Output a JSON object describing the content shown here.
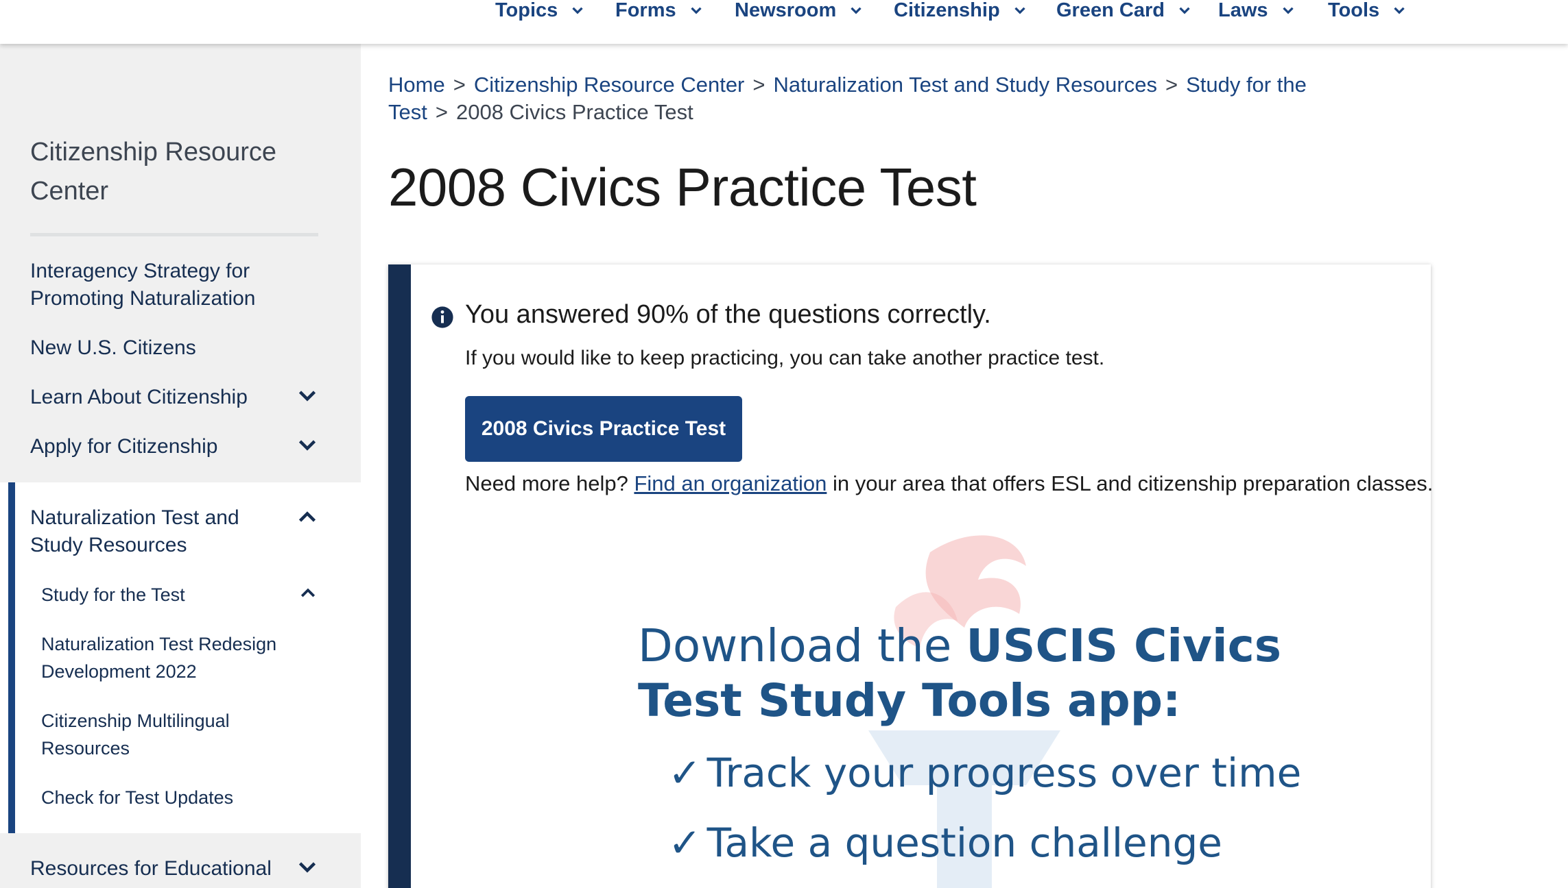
{
  "topnav": {
    "items": [
      {
        "label": "Topics"
      },
      {
        "label": "Forms"
      },
      {
        "label": "Newsroom"
      },
      {
        "label": "Citizenship"
      },
      {
        "label": "Green Card"
      },
      {
        "label": "Laws"
      },
      {
        "label": "Tools"
      }
    ]
  },
  "sidebar": {
    "title": "Citizenship Resource Center",
    "items": [
      {
        "label": "Interagency Strategy for Promoting Naturalization"
      },
      {
        "label": "New U.S. Citizens"
      },
      {
        "label": "Learn About Citizenship"
      },
      {
        "label": "Apply for Citizenship"
      },
      {
        "label": "Naturalization Test and Study Resources"
      },
      {
        "label": "Resources for Educational"
      }
    ],
    "subitems": [
      {
        "label": "Study for the Test"
      },
      {
        "label": "Naturalization Test Redesign Development 2022"
      },
      {
        "label": "Citizenship Multilingual Resources"
      },
      {
        "label": "Check for Test Updates"
      }
    ]
  },
  "breadcrumb": {
    "links": [
      "Home",
      "Citizenship Resource Center",
      "Naturalization Test and Study Resources",
      "Study for the Test"
    ],
    "current": "2008 Civics Practice Test"
  },
  "page": {
    "title": "2008 Civics Practice Test"
  },
  "result_card": {
    "result_text": "You answered 90% of the questions correctly.",
    "keep_text": "If you would like to keep practicing, you can take another practice test.",
    "button_label": "2008 Civics Practice Test",
    "help_prefix": "Need more help?",
    "help_link": "Find an organization",
    "help_suffix": "in your area that offers ESL and citizenship preparation classes."
  },
  "promo": {
    "line1_regular": "Download the ",
    "line1_bold": "USCIS Civics",
    "line2": "Test Study Tools app:",
    "bullet1": "Track your progress over time",
    "bullet2": "Take a question challenge",
    "check": "✓"
  },
  "colors": {
    "link": "#1a4480",
    "dark_navy": "#162e51",
    "button": "#1a4480",
    "sidebar_bg": "#f0f0f0"
  }
}
